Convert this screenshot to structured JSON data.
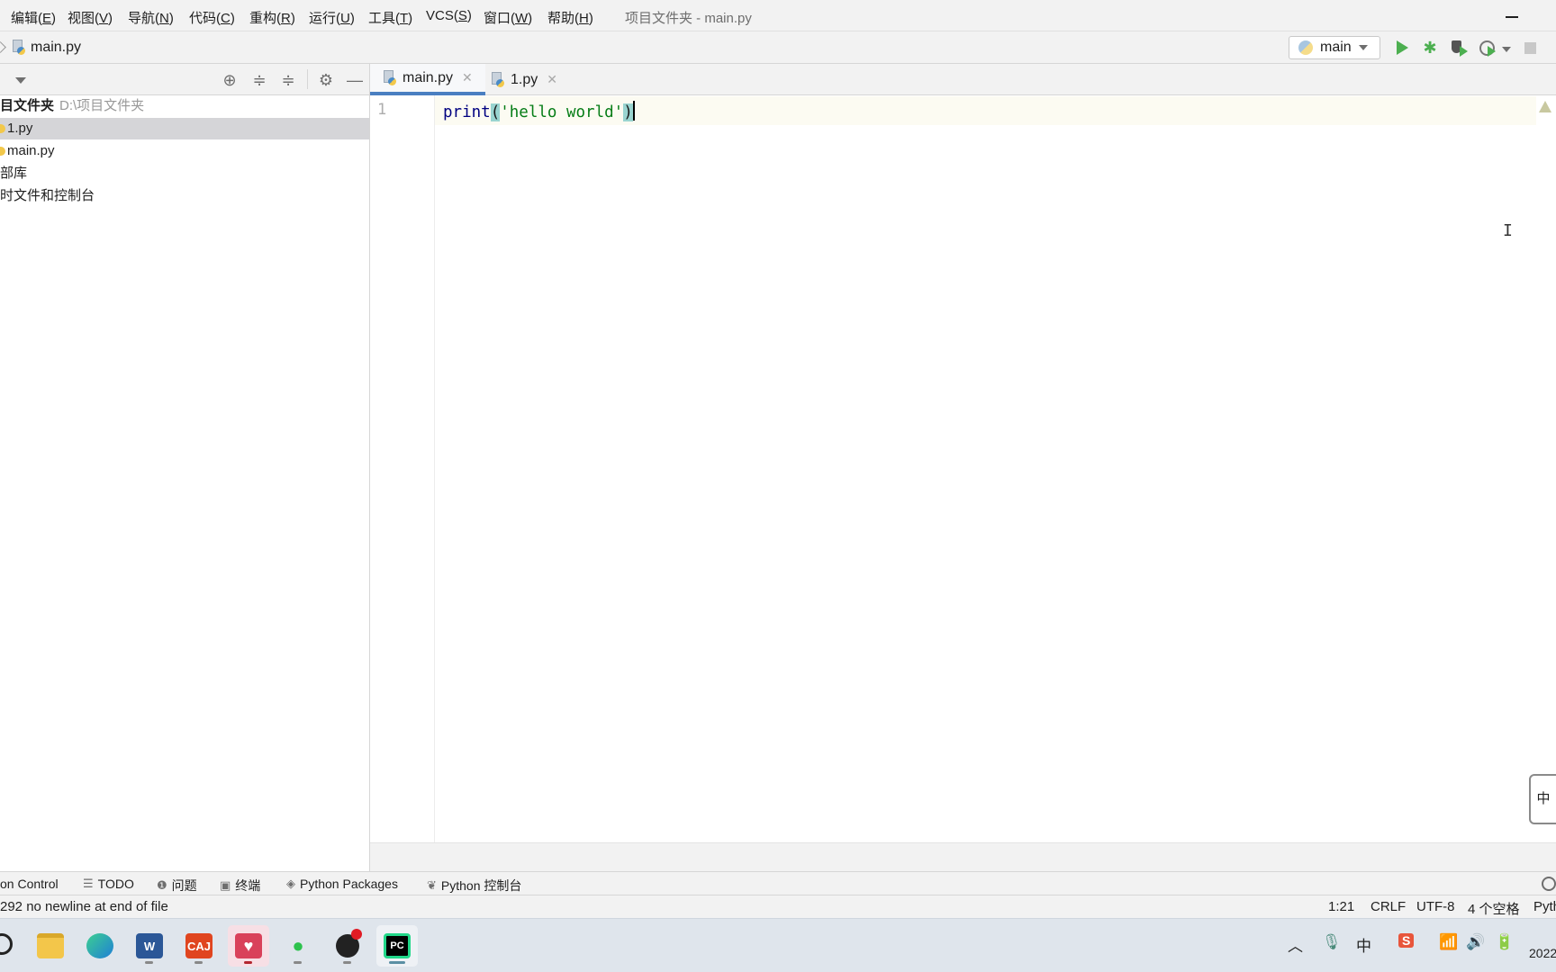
{
  "menu": {
    "items": [
      {
        "label": "编辑(",
        "key": "E",
        "end": ")"
      },
      {
        "label": "视图(",
        "key": "V",
        "end": ")"
      },
      {
        "label": "导航(",
        "key": "N",
        "end": ")"
      },
      {
        "label": "代码(",
        "key": "C",
        "end": ")"
      },
      {
        "label": "重构(",
        "key": "R",
        "end": ")"
      },
      {
        "label": "运行(",
        "key": "U",
        "end": ")"
      },
      {
        "label": "工具(",
        "key": "T",
        "end": ")"
      },
      {
        "label": "VCS(",
        "key": "S",
        "end": ")"
      },
      {
        "label": "窗口(",
        "key": "W",
        "end": ")"
      },
      {
        "label": "帮助(",
        "key": "H",
        "end": ")"
      }
    ],
    "window_title": "项目文件夹 - main.py"
  },
  "navbar": {
    "breadcrumb_file": "main.py",
    "run_config": "main"
  },
  "project": {
    "root_name": "目文件夹",
    "root_path": "D:\\项目文件夹",
    "files": [
      "1.py",
      "main.py"
    ],
    "selected": "1.py",
    "external_libs": "部库",
    "scratches": "时文件和控制台"
  },
  "tabs": [
    {
      "label": "main.py",
      "active": true
    },
    {
      "label": "1.py",
      "active": false
    }
  ],
  "editor": {
    "line_number": "1",
    "code": {
      "fn": "print",
      "open": "(",
      "str": "'hello world'",
      "close": ")"
    }
  },
  "ime_float": "中",
  "tool_strip": {
    "items": [
      {
        "icon": "vcs",
        "label": "on Control"
      },
      {
        "icon": "list-icon",
        "label": "TODO"
      },
      {
        "icon": "problems-icon",
        "label": "问题"
      },
      {
        "icon": "terminal-icon",
        "label": "终端"
      },
      {
        "icon": "packages-icon",
        "label": "Python Packages"
      },
      {
        "icon": "python-console-icon",
        "label": "Python 控制台"
      }
    ]
  },
  "status": {
    "message": "292 no newline at end of file",
    "position": "1:21",
    "line_sep": "CRLF",
    "encoding": "UTF-8",
    "indent": "4 个空格",
    "interpreter": "Pyth"
  },
  "taskbar": {
    "apps": [
      "File Explorer",
      "Edge",
      "Word",
      "CAJViewer",
      "Heart App",
      "WeChat",
      "OBS",
      "PyCharm"
    ],
    "cj_label": "CAJ",
    "word_label": "W",
    "pc_label": "PC",
    "tray_ime": "中",
    "clock": "2022"
  },
  "colors": {
    "accent": "#4a7fc1",
    "run_green": "#4caf50",
    "string_green": "#067d17",
    "keyword_navy": "#000080",
    "bracket_highlight": "#99d4d0"
  }
}
